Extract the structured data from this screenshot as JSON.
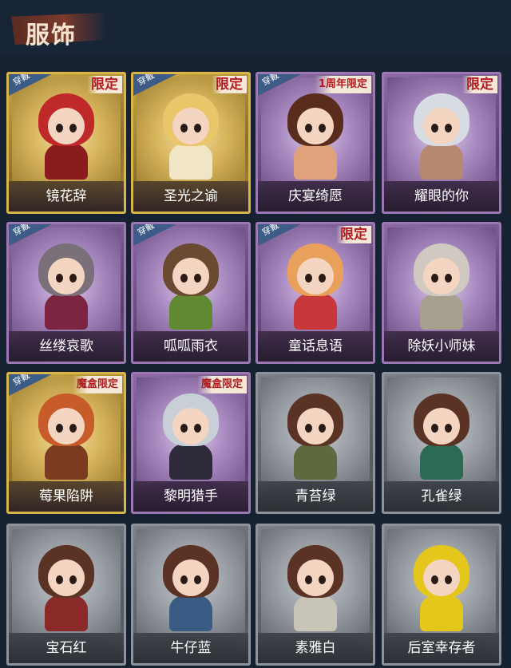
{
  "header": {
    "title": "服饰"
  },
  "worn_label": "穿戴",
  "colors": {
    "gold_frame": "#d7b548",
    "purple_frame": "#9b78b2",
    "grey_frame": "#8e939b",
    "limited_text": "#b01e22",
    "worn_tag": "#3c5b86"
  },
  "outfits": [
    {
      "name": "镜花辞",
      "tier": "gold",
      "worn": true,
      "tag": "限定",
      "hair": "#c0292a",
      "body": "#8a1c1e"
    },
    {
      "name": "圣光之谕",
      "tier": "gold",
      "worn": true,
      "tag": "限定",
      "hair": "#e9c66a",
      "body": "#f1e5c8"
    },
    {
      "name": "庆宴绮愿",
      "tier": "purple",
      "worn": true,
      "tag": "1周年限定",
      "hair": "#5a2c1e",
      "body": "#e0a27a"
    },
    {
      "name": "耀眼的你",
      "tier": "purple",
      "worn": false,
      "tag": "限定",
      "hair": "#d7dbe2",
      "body": "#b68a70"
    },
    {
      "name": "丝缕哀歌",
      "tier": "purple",
      "worn": true,
      "tag": "",
      "hair": "#7a707a",
      "body": "#7c2540"
    },
    {
      "name": "呱呱雨衣",
      "tier": "purple",
      "worn": true,
      "tag": "",
      "hair": "#6c4a32",
      "body": "#5f8a32"
    },
    {
      "name": "童话息语",
      "tier": "purple",
      "worn": true,
      "tag": "限定",
      "hair": "#e8a05a",
      "body": "#c8373a"
    },
    {
      "name": "除妖小师妹",
      "tier": "purple",
      "worn": false,
      "tag": "",
      "hair": "#cfc9c2",
      "body": "#a8a08f"
    },
    {
      "name": "莓果陷阱",
      "tier": "gold",
      "worn": true,
      "tag": "魔盒限定",
      "hair": "#c85b2a",
      "body": "#7a3b20"
    },
    {
      "name": "黎明猎手",
      "tier": "purple",
      "worn": false,
      "tag": "魔盒限定",
      "hair": "#c9cfd6",
      "body": "#2e2a3a"
    },
    {
      "name": "青苔绿",
      "tier": "grey",
      "worn": false,
      "tag": "",
      "hair": "#5a3324",
      "body": "#5d6a3e"
    },
    {
      "name": "孔雀绿",
      "tier": "grey",
      "worn": false,
      "tag": "",
      "hair": "#5a3324",
      "body": "#2d6a55"
    },
    {
      "name": "宝石红",
      "tier": "grey",
      "worn": false,
      "tag": "",
      "hair": "#5a3324",
      "body": "#8a2a28"
    },
    {
      "name": "牛仔蓝",
      "tier": "grey",
      "worn": false,
      "tag": "",
      "hair": "#5a3324",
      "body": "#3a5c84"
    },
    {
      "name": "素雅白",
      "tier": "grey",
      "worn": false,
      "tag": "",
      "hair": "#5a3324",
      "body": "#c9c4b8"
    },
    {
      "name": "后室幸存者",
      "tier": "grey",
      "worn": false,
      "tag": "",
      "hair": "#e4c71a",
      "body": "#e4c71a"
    }
  ]
}
